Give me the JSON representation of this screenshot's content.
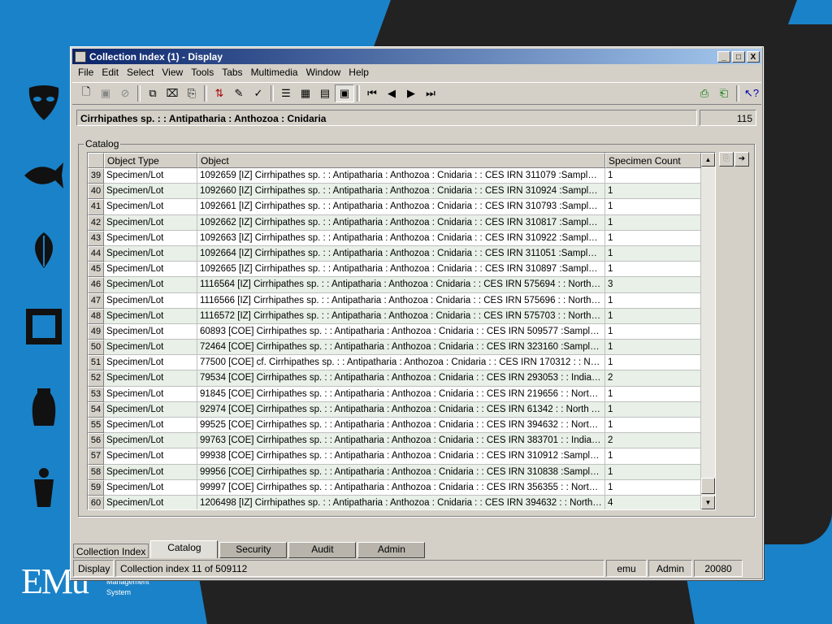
{
  "window": {
    "title": "Collection Index (1) - Display",
    "minimize": "_",
    "maximize": "□",
    "close": "X"
  },
  "menu": [
    "File",
    "Edit",
    "Select",
    "View",
    "Tools",
    "Tabs",
    "Multimedia",
    "Window",
    "Help"
  ],
  "record": {
    "title": "Cirrhipathes sp. : : Antipatharia : Anthozoa : Cnidaria",
    "count": "115"
  },
  "catalog": {
    "group_label": "Catalog",
    "headers": {
      "type": "Object Type",
      "object": "Object",
      "count": "Specimen Count"
    },
    "rows": [
      {
        "n": "39",
        "type": "Specimen/Lot",
        "object": "1092659 [IZ] Cirrhipathes sp. : : Antipatharia : Anthozoa : Cnidaria : : CES IRN 311079 :Sample n...",
        "count": "1"
      },
      {
        "n": "40",
        "type": "Specimen/Lot",
        "object": "1092660 [IZ] Cirrhipathes sp. : : Antipatharia : Anthozoa : Cnidaria : : CES IRN 310924 :Sample n...",
        "count": "1"
      },
      {
        "n": "41",
        "type": "Specimen/Lot",
        "object": "1092661 [IZ] Cirrhipathes sp. : : Antipatharia : Anthozoa : Cnidaria : : CES IRN 310793 :Sample n...",
        "count": "1"
      },
      {
        "n": "42",
        "type": "Specimen/Lot",
        "object": "1092662 [IZ] Cirrhipathes sp. : : Antipatharia : Anthozoa : Cnidaria : : CES IRN 310817 :Sample n...",
        "count": "1"
      },
      {
        "n": "43",
        "type": "Specimen/Lot",
        "object": "1092663 [IZ] Cirrhipathes sp. : : Antipatharia : Anthozoa : Cnidaria : : CES IRN 310922 :Sample n...",
        "count": "1"
      },
      {
        "n": "44",
        "type": "Specimen/Lot",
        "object": "1092664 [IZ] Cirrhipathes sp. : : Antipatharia : Anthozoa : Cnidaria : : CES IRN 311051 :Sample n...",
        "count": "1"
      },
      {
        "n": "45",
        "type": "Specimen/Lot",
        "object": "1092665 [IZ] Cirrhipathes sp. : : Antipatharia : Anthozoa : Cnidaria : : CES IRN 310897 :Sample n...",
        "count": "1"
      },
      {
        "n": "46",
        "type": "Specimen/Lot",
        "object": "1116564 [IZ] Cirrhipathes sp. : : Antipatharia : Anthozoa : Cnidaria : : CES IRN 575694 : : North P...",
        "count": "3"
      },
      {
        "n": "47",
        "type": "Specimen/Lot",
        "object": "1116566 [IZ] Cirrhipathes sp. : : Antipatharia : Anthozoa : Cnidaria : : CES IRN 575696 : : North P...",
        "count": "1"
      },
      {
        "n": "48",
        "type": "Specimen/Lot",
        "object": "1116572 [IZ] Cirrhipathes sp. : : Antipatharia : Anthozoa : Cnidaria : : CES IRN 575703 : : North P...",
        "count": "1"
      },
      {
        "n": "49",
        "type": "Specimen/Lot",
        "object": "60893 [COE] Cirrhipathes sp. : : Antipatharia : Anthozoa : Cnidaria : : CES IRN 509577 :Sample n...",
        "count": "1"
      },
      {
        "n": "50",
        "type": "Specimen/Lot",
        "object": "72464 [COE] Cirrhipathes sp. : : Antipatharia : Anthozoa : Cnidaria : : CES IRN 323160 :Sample n...",
        "count": "1"
      },
      {
        "n": "51",
        "type": "Specimen/Lot",
        "object": "77500 [COE] cf. Cirrhipathes sp. : : Antipatharia : Anthozoa : Cnidaria : : CES IRN 170312 : : Nort...",
        "count": "1"
      },
      {
        "n": "52",
        "type": "Specimen/Lot",
        "object": "79534 [COE] Cirrhipathes sp. : : Antipatharia : Anthozoa : Cnidaria : : CES IRN 293053 : : Indian ...",
        "count": "2"
      },
      {
        "n": "53",
        "type": "Specimen/Lot",
        "object": "91845 [COE] Cirrhipathes sp. : : Antipatharia : Anthozoa : Cnidaria : : CES IRN 219656 : : North P...",
        "count": "1"
      },
      {
        "n": "54",
        "type": "Specimen/Lot",
        "object": "92974 [COE] Cirrhipathes sp. : : Antipatharia : Anthozoa : Cnidaria : : CES IRN 61342 : : North Atl...",
        "count": "1"
      },
      {
        "n": "55",
        "type": "Specimen/Lot",
        "object": "99525 [COE] Cirrhipathes sp. : : Antipatharia : Anthozoa : Cnidaria : : CES IRN 394632 : : North P...",
        "count": "1"
      },
      {
        "n": "56",
        "type": "Specimen/Lot",
        "object": "99763 [COE] Cirrhipathes sp. : : Antipatharia : Anthozoa : Cnidaria : : CES IRN 383701 : : Indian ...",
        "count": "2"
      },
      {
        "n": "57",
        "type": "Specimen/Lot",
        "object": "99938 [COE] Cirrhipathes sp. : : Antipatharia : Anthozoa : Cnidaria : : CES IRN 310912 :Sample n...",
        "count": "1"
      },
      {
        "n": "58",
        "type": "Specimen/Lot",
        "object": "99956 [COE] Cirrhipathes sp. : : Antipatharia : Anthozoa : Cnidaria : : CES IRN 310838 :Sample n...",
        "count": "1"
      },
      {
        "n": "59",
        "type": "Specimen/Lot",
        "object": "99997 [COE] Cirrhipathes sp. : : Antipatharia : Anthozoa : Cnidaria : : CES IRN 356355 : : North P...",
        "count": "1"
      },
      {
        "n": "60",
        "type": "Specimen/Lot",
        "object": "1206498 [IZ] Cirrhipathes sp. : : Antipatharia : Anthozoa : Cnidaria : : CES IRN 394632 : : North P...",
        "count": "4"
      }
    ]
  },
  "tabs": {
    "label": "Collection Index",
    "items": [
      "Catalog",
      "Security",
      "Audit",
      "Admin"
    ]
  },
  "status": {
    "mode": "Display",
    "message": "Collection index 11 of 509112",
    "user": "emu",
    "group": "Admin",
    "port": "20080"
  },
  "branding": {
    "logo": "EMu",
    "subtitle_line1": "Management",
    "subtitle_line2": "System"
  },
  "colors": {
    "desktop": "#1a82c8",
    "titlebar": "#0a246a"
  }
}
